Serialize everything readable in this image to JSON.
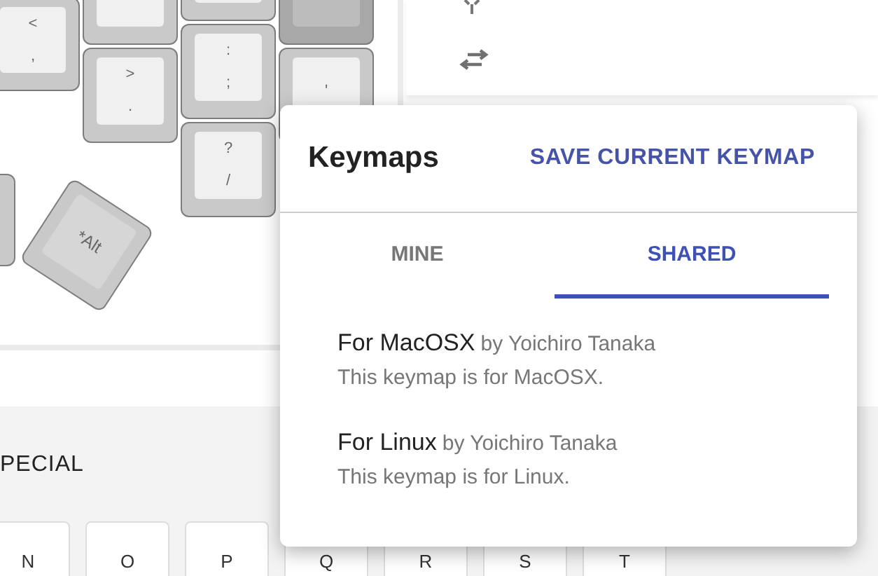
{
  "keyboard": {
    "keys": [
      {
        "top": "<",
        "bottom": ","
      },
      {
        "top": ">",
        "bottom": "."
      },
      {
        "top": ":",
        "bottom": ";"
      },
      {
        "top": "?",
        "bottom": "/"
      },
      {
        "top": "'"
      },
      {
        "label": "*Alt"
      }
    ]
  },
  "category_tab": "PECIAL",
  "key_row": [
    "N",
    "O",
    "P",
    "Q",
    "R",
    "S",
    "T"
  ],
  "keymaps_popup": {
    "title": "Keymaps",
    "action": "SAVE CURRENT KEYMAP",
    "tabs": [
      {
        "label": "MINE",
        "selected": false
      },
      {
        "label": "SHARED",
        "selected": true
      }
    ],
    "items": [
      {
        "name": "For MacOSX",
        "author": "by Yoichiro Tanaka",
        "description": "This keymap is for MacOSX."
      },
      {
        "name": "For Linux",
        "author": "by Yoichiro Tanaka",
        "description": "This keymap is for Linux."
      }
    ]
  }
}
